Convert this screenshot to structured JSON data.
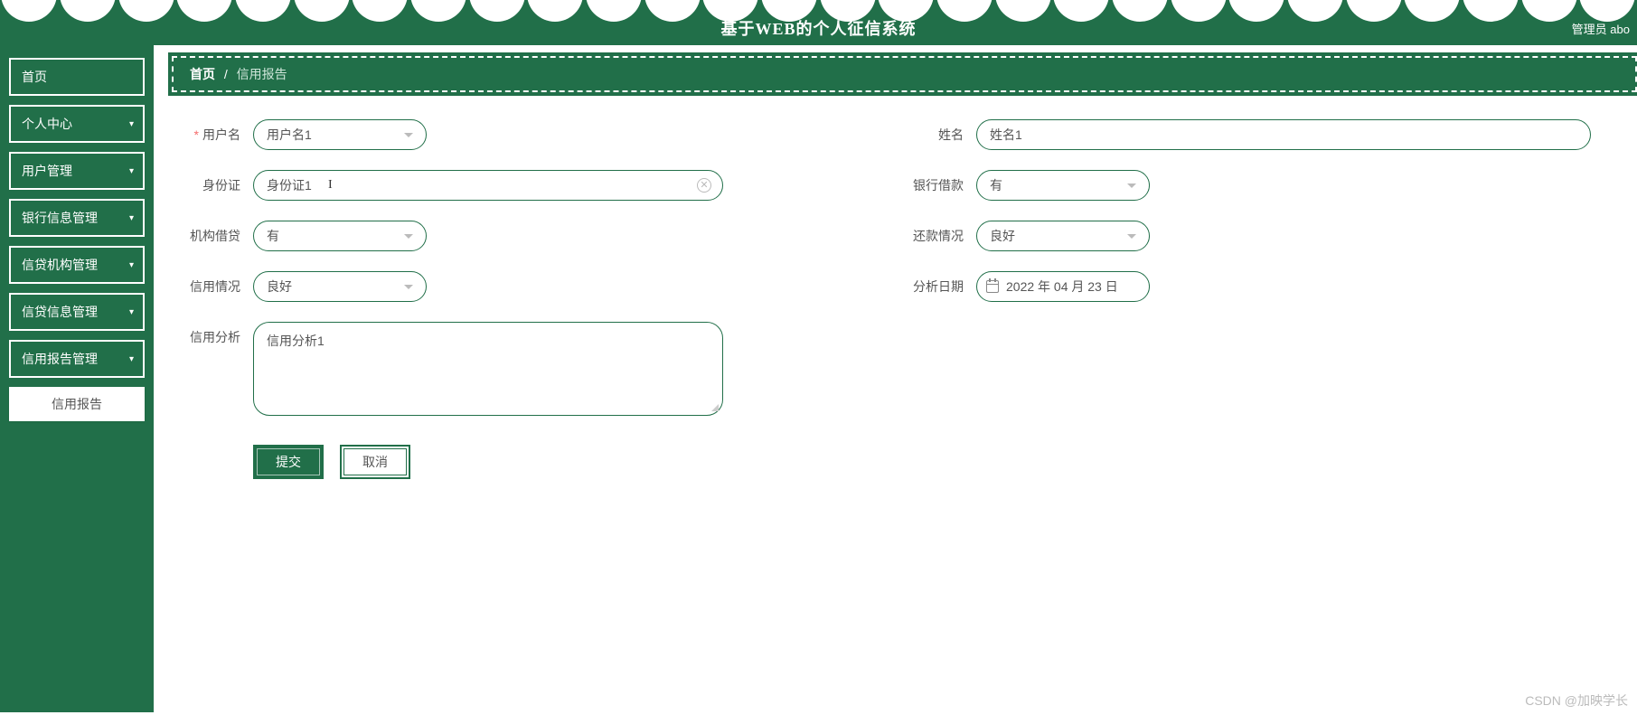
{
  "header": {
    "title": "基于WEB的个人征信系统",
    "user_role": "管理员",
    "user_name": "abo"
  },
  "sidebar": {
    "items": [
      {
        "label": "首页",
        "has_children": false
      },
      {
        "label": "个人中心",
        "has_children": true
      },
      {
        "label": "用户管理",
        "has_children": true
      },
      {
        "label": "银行信息管理",
        "has_children": true
      },
      {
        "label": "信贷机构管理",
        "has_children": true
      },
      {
        "label": "信贷信息管理",
        "has_children": true
      },
      {
        "label": "信用报告管理",
        "has_children": true
      }
    ],
    "active_submenu": "信用报告"
  },
  "breadcrumb": {
    "home": "首页",
    "separator": "/",
    "current": "信用报告"
  },
  "form": {
    "username_label": "用户名",
    "username_value": "用户名1",
    "fullname_label": "姓名",
    "fullname_value": "姓名1",
    "idcard_label": "身份证",
    "idcard_value": "身份证1",
    "bank_loan_label": "银行借款",
    "bank_loan_value": "有",
    "org_loan_label": "机构借贷",
    "org_loan_value": "有",
    "repay_label": "还款情况",
    "repay_value": "良好",
    "credit_status_label": "信用情况",
    "credit_status_value": "良好",
    "analysis_date_label": "分析日期",
    "analysis_date_value": "2022 年 04 月 23 日",
    "credit_analysis_label": "信用分析",
    "credit_analysis_value": "信用分析1"
  },
  "buttons": {
    "submit": "提交",
    "cancel": "取消"
  },
  "watermark": "CSDN @加映学长"
}
